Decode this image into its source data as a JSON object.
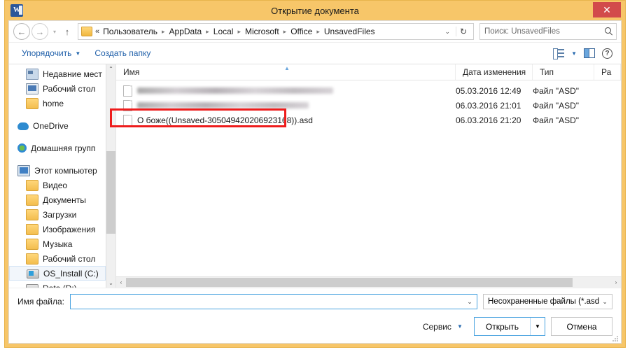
{
  "window": {
    "title": "Открытие документа",
    "app_icon": "word-icon",
    "close_label": "✕"
  },
  "address_bar": {
    "back_icon": "←",
    "forward_icon": "→",
    "history_icon": "▾",
    "up_icon": "↑",
    "folder_icon": "folder-icon",
    "double_chevron": "«",
    "crumbs": [
      "Пользователь",
      "AppData",
      "Local",
      "Microsoft",
      "Office",
      "UnsavedFiles"
    ],
    "separator": "▸",
    "dropdown_icon": "⌄",
    "refresh_icon": "↻",
    "search": {
      "placeholder": "Поиск: UnsavedFiles",
      "value": "",
      "icon": "search-icon"
    }
  },
  "toolbar": {
    "organize_label": "Упорядочить",
    "organize_caret": "▼",
    "new_folder_label": "Создать папку",
    "view_icon": "view-options-icon",
    "view_caret": "▼",
    "preview_pane_icon": "preview-pane-icon",
    "help_icon": "?"
  },
  "sidebar": {
    "groups": [
      {
        "items": [
          {
            "label": "Недавние мест",
            "icon": "recent-places-icon",
            "level": "indent"
          },
          {
            "label": "Рабочий стол",
            "icon": "desktop-icon",
            "level": "indent"
          },
          {
            "label": "home",
            "icon": "folder-icon",
            "level": "indent"
          }
        ]
      },
      {
        "items": [
          {
            "label": "OneDrive",
            "icon": "onedrive-icon",
            "level": "root"
          }
        ]
      },
      {
        "items": [
          {
            "label": "Домашняя групп",
            "icon": "homegroup-icon",
            "level": "root"
          }
        ]
      },
      {
        "items": [
          {
            "label": "Этот компьютер",
            "icon": "this-pc-icon",
            "level": "root"
          },
          {
            "label": "Видео",
            "icon": "folder-icon",
            "level": "indent"
          },
          {
            "label": "Документы",
            "icon": "folder-icon",
            "level": "indent"
          },
          {
            "label": "Загрузки",
            "icon": "folder-icon",
            "level": "indent"
          },
          {
            "label": "Изображения",
            "icon": "folder-icon",
            "level": "indent"
          },
          {
            "label": "Музыка",
            "icon": "folder-icon",
            "level": "indent"
          },
          {
            "label": "Рабочий стол",
            "icon": "folder-icon",
            "level": "indent"
          },
          {
            "label": "OS_Install (C:)",
            "icon": "drive-windows-icon",
            "level": "indent",
            "selected": true
          },
          {
            "label": "Data (D:)",
            "icon": "drive-icon",
            "level": "indent"
          }
        ]
      }
    ],
    "scrollbar": {
      "up_icon": "⌃",
      "down_icon": "⌄"
    }
  },
  "file_list": {
    "columns": [
      "Имя",
      "Дата изменения",
      "Тип",
      "Ра"
    ],
    "sort_indicator": "▲",
    "rows": [
      {
        "name": "",
        "redacted": true,
        "date": "05.03.2016 12:49",
        "type": "Файл \"ASD\"",
        "size": ""
      },
      {
        "name": "",
        "redacted": true,
        "date": "06.03.2016 21:01",
        "type": "Файл \"ASD\"",
        "size": ""
      },
      {
        "name": "О боже((Unsaved-305049420206923168)).asd",
        "redacted": false,
        "date": "06.03.2016 21:20",
        "type": "Файл \"ASD\"",
        "size": ""
      }
    ],
    "scrollbar": {
      "left_icon": "‹",
      "right_icon": "›"
    }
  },
  "annotation": {
    "color": "#ee1c1c",
    "target": "О боже((Unsaved-305049420206923168)).asd"
  },
  "footer": {
    "filename_label": "Имя файла:",
    "filename_value": "",
    "filename_caret": "⌄",
    "filter_value": "Несохраненные файлы (*.asd)",
    "filter_caret": "⌄",
    "tools_label": "Сервис",
    "tools_caret": "▼",
    "open_label": "Открыть",
    "open_caret": "▼",
    "cancel_label": "Отмена"
  }
}
